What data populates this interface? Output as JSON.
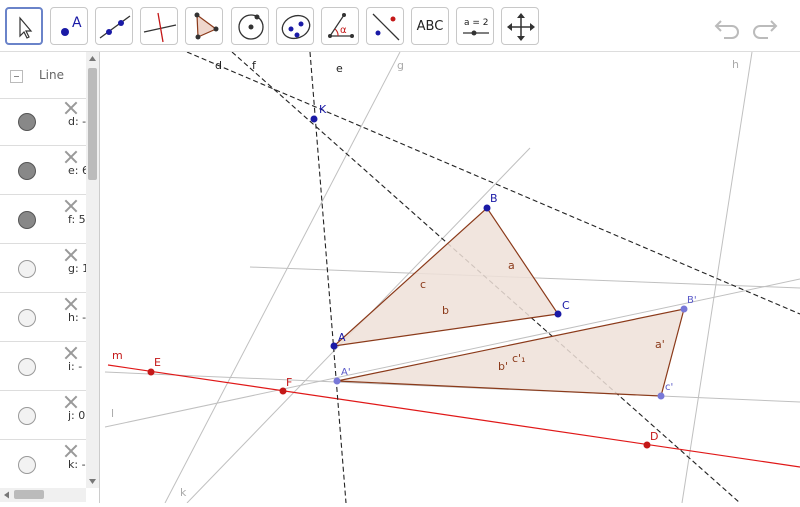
{
  "toolbar": {
    "tools": [
      {
        "name": "move-tool",
        "icon": "cursor-arrow-icon"
      },
      {
        "name": "point-tool",
        "icon": "point-icon",
        "label": "A"
      },
      {
        "name": "line-tool",
        "icon": "line-icon"
      },
      {
        "name": "perpendicular-line-tool",
        "icon": "perpendicular-line-icon"
      },
      {
        "name": "polygon-tool",
        "icon": "polygon-icon"
      },
      {
        "name": "circle-tool",
        "icon": "circle-center-point-icon"
      },
      {
        "name": "conic-tool",
        "icon": "ellipse-icon"
      },
      {
        "name": "angle-tool",
        "icon": "angle-icon",
        "label": "α"
      },
      {
        "name": "reflect-tool",
        "icon": "reflect-about-line-icon"
      },
      {
        "name": "text-tool",
        "label": "ABC"
      },
      {
        "name": "slider-tool",
        "label": "a = 2"
      },
      {
        "name": "move-graphics-view-tool",
        "icon": "move-arrows-icon"
      }
    ],
    "undo_icon": "undo-icon",
    "redo_icon": "redo-icon"
  },
  "algebra": {
    "title": "Line",
    "rows": [
      {
        "label": "d: -",
        "filled": true
      },
      {
        "label": "e: 6",
        "filled": true
      },
      {
        "label": "f: 5",
        "filled": true
      },
      {
        "label": "g: 1",
        "filled": false
      },
      {
        "label": "h: -",
        "filled": false
      },
      {
        "label": "i: -",
        "filled": false
      },
      {
        "label": "j: 0",
        "filled": false
      },
      {
        "label": "k: -",
        "filled": false
      }
    ]
  },
  "graphics": {
    "line_labels": {
      "d": "d",
      "e": "e",
      "f": "f",
      "g": "g",
      "h": "h",
      "k": "k",
      "l": "l",
      "m": "m"
    },
    "points": {
      "K": "K",
      "B": "B",
      "C": "C",
      "A": "A",
      "E": "E",
      "F": "F",
      "D": "D",
      "A1": "A'",
      "B1": "B'",
      "C1": "c'"
    },
    "segments": {
      "a": "a",
      "b": "b",
      "c": "c",
      "a1": "a'",
      "b1": "b'",
      "c1": "c'₁"
    },
    "colors": {
      "triangle_fill": "#efe0d8",
      "triangle_stroke": "#8b3a1a",
      "point_blue": "#1a1aa6",
      "point_light": "#7878d8",
      "point_red": "#c41818",
      "line_red": "#e01818",
      "line_gray": "#c0c0c0",
      "dashed": "#222222"
    }
  }
}
